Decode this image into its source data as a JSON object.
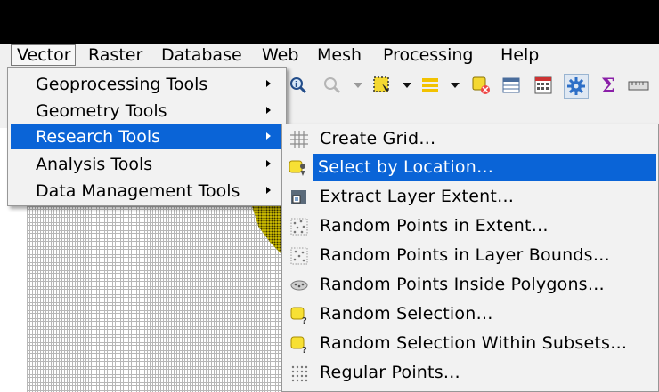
{
  "menubar": {
    "items": [
      {
        "label": "Vector"
      },
      {
        "label": "Raster"
      },
      {
        "label": "Database"
      },
      {
        "label": "Web"
      },
      {
        "label": "Mesh"
      },
      {
        "label": "Processing"
      },
      {
        "label": "Help"
      }
    ]
  },
  "vector_menu": {
    "items": [
      {
        "label": "Geoprocessing Tools"
      },
      {
        "label": "Geometry Tools"
      },
      {
        "label": "Research Tools"
      },
      {
        "label": "Analysis Tools"
      },
      {
        "label": "Data Management Tools"
      }
    ],
    "highlighted_index": 2
  },
  "research_menu": {
    "items": [
      {
        "label": "Create Grid…",
        "icon": "grid-icon"
      },
      {
        "label": "Select by Location…",
        "icon": "select-location-icon"
      },
      {
        "label": "Extract Layer Extent…",
        "icon": "layer-extent-icon"
      },
      {
        "label": "Random Points in Extent…",
        "icon": "random-points-icon"
      },
      {
        "label": "Random Points in Layer Bounds…",
        "icon": "random-points-bounds-icon"
      },
      {
        "label": "Random Points Inside Polygons…",
        "icon": "random-points-polygons-icon"
      },
      {
        "label": "Random Selection…",
        "icon": "random-selection-icon"
      },
      {
        "label": "Random Selection Within Subsets…",
        "icon": "random-selection-subsets-icon"
      },
      {
        "label": "Regular Points…",
        "icon": "regular-points-icon"
      }
    ],
    "highlighted_index": 1
  },
  "toolbar": {
    "icons": [
      "identify-icon",
      "zoom-icon",
      "select-features-icon",
      "select-layer-icon",
      "deselect-icon",
      "attribute-table-icon",
      "field-calculator-icon",
      "settings-gear-icon",
      "statistics-sigma-icon",
      "measure-icon"
    ]
  },
  "colors": {
    "highlight": "#0a64d7",
    "menu_bg": "#f2f2f2",
    "feature_yellow": "#e6d400"
  }
}
